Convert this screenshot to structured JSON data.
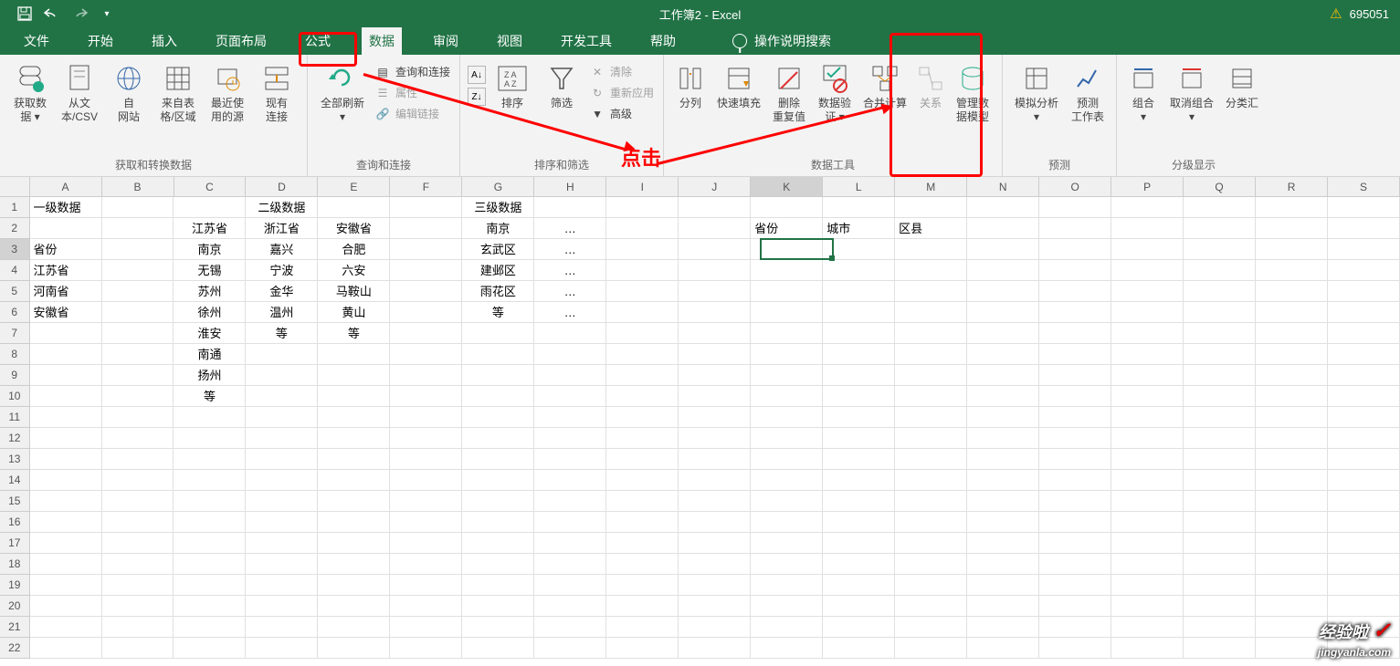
{
  "title": "工作簿2 - Excel",
  "account": "695051",
  "tabs": {
    "file": "文件",
    "home": "开始",
    "insert": "插入",
    "layout": "页面布局",
    "formulas": "公式",
    "data": "数据",
    "review": "审阅",
    "view": "视图",
    "developer": "开发工具",
    "help": "帮助",
    "tell_me": "操作说明搜索"
  },
  "ribbon": {
    "get_data": "获取数\n据 ▾",
    "from_csv": "从文\n本/CSV",
    "from_web": "自\n网站",
    "from_table": "来自表\n格/区域",
    "recent": "最近使\n用的源",
    "existing": "现有\n连接",
    "group_get": "获取和转换数据",
    "refresh_all": "全部刷新\n▾",
    "queries": "查询和连接",
    "properties": "属性",
    "edit_links": "编辑链接",
    "group_conn": "查询和连接",
    "sort": "排序",
    "filter": "筛选",
    "clear": "清除",
    "reapply": "重新应用",
    "advanced": "高级",
    "group_sort": "排序和筛选",
    "text_to_cols": "分列",
    "flash_fill": "快速填充",
    "remove_dup": "删除\n重复值",
    "data_validation": "数据验\n证 ▾",
    "consolidate": "合并计算",
    "relationships": "关系",
    "data_model": "管理数\n据模型",
    "group_tools": "数据工具",
    "whatif": "模拟分析\n▾",
    "forecast": "预测\n工作表",
    "group_forecast": "预测",
    "grp": "组合\n▾",
    "ungroup": "取消组合\n▾",
    "subtotal": "分类汇",
    "group_outline": "分级显示"
  },
  "annotation": {
    "click": "点击"
  },
  "columns": [
    "A",
    "B",
    "C",
    "D",
    "E",
    "F",
    "G",
    "H",
    "I",
    "J",
    "K",
    "L",
    "M",
    "N",
    "O",
    "P",
    "Q",
    "R",
    "S"
  ],
  "row_labels": [
    "1",
    "2",
    "3",
    "4",
    "5",
    "6",
    "7",
    "8",
    "9",
    "10",
    "11",
    "12",
    "13",
    "14",
    "15",
    "16",
    "17",
    "18",
    "19",
    "20",
    "21",
    "22"
  ],
  "grid": {
    "r1": {
      "A": "一级数据",
      "D": "二级数据",
      "G": "三级数据"
    },
    "r2": {
      "C": "江苏省",
      "D": "浙江省",
      "E": "安徽省",
      "G": "南京",
      "H": "…",
      "K": "省份",
      "L": "城市",
      "M": "区县"
    },
    "r3": {
      "A": "省份",
      "C": "南京",
      "D": "嘉兴",
      "E": "合肥",
      "G": "玄武区",
      "H": "…"
    },
    "r4": {
      "A": "江苏省",
      "C": "无锡",
      "D": "宁波",
      "E": "六安",
      "G": "建邺区",
      "H": "…"
    },
    "r5": {
      "A": "河南省",
      "C": "苏州",
      "D": "金华",
      "E": "马鞍山",
      "G": "雨花区",
      "H": "…"
    },
    "r6": {
      "A": "安徽省",
      "C": "徐州",
      "D": "温州",
      "E": "黄山",
      "G": "等",
      "H": "…"
    },
    "r7": {
      "C": "淮安",
      "D": "等",
      "E": "等"
    },
    "r8": {
      "C": "南通"
    },
    "r9": {
      "C": "扬州"
    },
    "r10": {
      "C": "等"
    }
  },
  "watermark": {
    "main": "经验啦",
    "sub": "jingyanla.com"
  }
}
